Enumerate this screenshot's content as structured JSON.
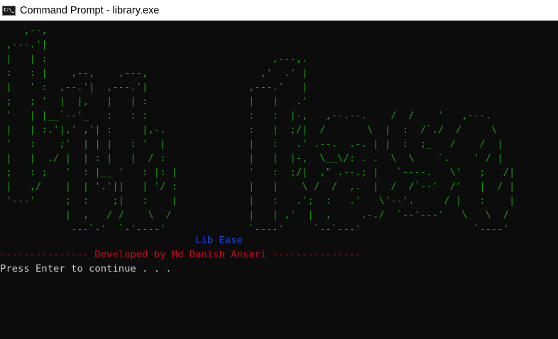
{
  "window": {
    "title": "Command Prompt - library.exe",
    "icon": "command-prompt-icon"
  },
  "console": {
    "ascii_banner": "    ,--,\n ,---.'|\n |   | :                                      ,---,.\n :   : |    ,--,    ,---,                   ,'  .' |\n |   ' :  ,--.'|  ,---.'|                 ,---.'   |\n ;   ; '  |  |,   |   | :                 |   |   .'\n '   | |__`--'_   :   : :                 :   :  |-,   ,--.--.    /  /    '   ,---.\n |   | :.'|,' ,'| :     |,-.              :   |  ;/|  /       \\  |  :  /`./  /     \\\n '   :    ;'  | | |   : '  |              |   :   .' .--.  .-. | |  :  ;_   /    /  |\n |   |  ./ |  | : |   |  / :              |   |  |-,  \\__\\/: . .  \\  \\    `.    ' / |\n ;   : ;   '  : |__ '   : |: |            '   :  ;/|  ,\" .--.; |   `----.   \\'   ;   /|\n |   ,/    |  | '.'||   | '/ :            |   |    \\ /  /  ,.  |  /  /`--'  /'   |  / |\n '---'     ;  :    ;|   :    |            |   :   .';  :   .'   \\'--'.     / |   :    |\n           |  ,   / /    \\  /             |   | ,'  |  ,     .-./  `--'---'   \\   \\  /\n            ---`-'  `-'----'              `----'     `--`---'                   `----'",
    "app_name": "Lib Ease",
    "developer_line": "--------------- Developed by Md Danish Ansari ---------------",
    "prompt": "Press Enter to continue . . ."
  },
  "colors": {
    "background": "#0c0c0c",
    "ascii_green": "#13a10e",
    "title_blue": "#2247d6",
    "credit_red": "#c50f1f",
    "text_gray": "#cccccc"
  }
}
